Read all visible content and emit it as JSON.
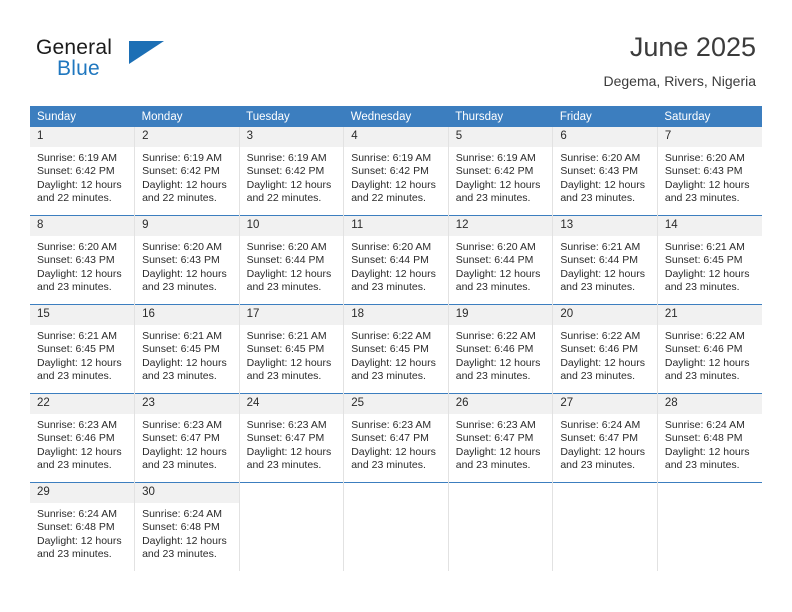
{
  "brand": {
    "word_one": "General",
    "word_two": "Blue",
    "flag_icon": "triangle-flag-icon",
    "colors": {
      "blue": "#1c6fb5",
      "text": "#1b1b1b"
    }
  },
  "header": {
    "title": "June 2025",
    "subtitle": "Degema, Rivers, Nigeria"
  },
  "theme": {
    "header_row_bg": "#3c7ebf",
    "daynum_bg": "#f1f1f1",
    "grid_line": "#e2e2e2",
    "week_divider": "#3c7ebf"
  },
  "calendar": {
    "weekday_headers": [
      "Sunday",
      "Monday",
      "Tuesday",
      "Wednesday",
      "Thursday",
      "Friday",
      "Saturday"
    ],
    "weeks": [
      [
        {
          "day": "1",
          "sunrise": "Sunrise: 6:19 AM",
          "sunset": "Sunset: 6:42 PM",
          "daylight_line1": "Daylight: 12 hours",
          "daylight_line2": "and 22 minutes."
        },
        {
          "day": "2",
          "sunrise": "Sunrise: 6:19 AM",
          "sunset": "Sunset: 6:42 PM",
          "daylight_line1": "Daylight: 12 hours",
          "daylight_line2": "and 22 minutes."
        },
        {
          "day": "3",
          "sunrise": "Sunrise: 6:19 AM",
          "sunset": "Sunset: 6:42 PM",
          "daylight_line1": "Daylight: 12 hours",
          "daylight_line2": "and 22 minutes."
        },
        {
          "day": "4",
          "sunrise": "Sunrise: 6:19 AM",
          "sunset": "Sunset: 6:42 PM",
          "daylight_line1": "Daylight: 12 hours",
          "daylight_line2": "and 22 minutes."
        },
        {
          "day": "5",
          "sunrise": "Sunrise: 6:19 AM",
          "sunset": "Sunset: 6:42 PM",
          "daylight_line1": "Daylight: 12 hours",
          "daylight_line2": "and 23 minutes."
        },
        {
          "day": "6",
          "sunrise": "Sunrise: 6:20 AM",
          "sunset": "Sunset: 6:43 PM",
          "daylight_line1": "Daylight: 12 hours",
          "daylight_line2": "and 23 minutes."
        },
        {
          "day": "7",
          "sunrise": "Sunrise: 6:20 AM",
          "sunset": "Sunset: 6:43 PM",
          "daylight_line1": "Daylight: 12 hours",
          "daylight_line2": "and 23 minutes."
        }
      ],
      [
        {
          "day": "8",
          "sunrise": "Sunrise: 6:20 AM",
          "sunset": "Sunset: 6:43 PM",
          "daylight_line1": "Daylight: 12 hours",
          "daylight_line2": "and 23 minutes."
        },
        {
          "day": "9",
          "sunrise": "Sunrise: 6:20 AM",
          "sunset": "Sunset: 6:43 PM",
          "daylight_line1": "Daylight: 12 hours",
          "daylight_line2": "and 23 minutes."
        },
        {
          "day": "10",
          "sunrise": "Sunrise: 6:20 AM",
          "sunset": "Sunset: 6:44 PM",
          "daylight_line1": "Daylight: 12 hours",
          "daylight_line2": "and 23 minutes."
        },
        {
          "day": "11",
          "sunrise": "Sunrise: 6:20 AM",
          "sunset": "Sunset: 6:44 PM",
          "daylight_line1": "Daylight: 12 hours",
          "daylight_line2": "and 23 minutes."
        },
        {
          "day": "12",
          "sunrise": "Sunrise: 6:20 AM",
          "sunset": "Sunset: 6:44 PM",
          "daylight_line1": "Daylight: 12 hours",
          "daylight_line2": "and 23 minutes."
        },
        {
          "day": "13",
          "sunrise": "Sunrise: 6:21 AM",
          "sunset": "Sunset: 6:44 PM",
          "daylight_line1": "Daylight: 12 hours",
          "daylight_line2": "and 23 minutes."
        },
        {
          "day": "14",
          "sunrise": "Sunrise: 6:21 AM",
          "sunset": "Sunset: 6:45 PM",
          "daylight_line1": "Daylight: 12 hours",
          "daylight_line2": "and 23 minutes."
        }
      ],
      [
        {
          "day": "15",
          "sunrise": "Sunrise: 6:21 AM",
          "sunset": "Sunset: 6:45 PM",
          "daylight_line1": "Daylight: 12 hours",
          "daylight_line2": "and 23 minutes."
        },
        {
          "day": "16",
          "sunrise": "Sunrise: 6:21 AM",
          "sunset": "Sunset: 6:45 PM",
          "daylight_line1": "Daylight: 12 hours",
          "daylight_line2": "and 23 minutes."
        },
        {
          "day": "17",
          "sunrise": "Sunrise: 6:21 AM",
          "sunset": "Sunset: 6:45 PM",
          "daylight_line1": "Daylight: 12 hours",
          "daylight_line2": "and 23 minutes."
        },
        {
          "day": "18",
          "sunrise": "Sunrise: 6:22 AM",
          "sunset": "Sunset: 6:45 PM",
          "daylight_line1": "Daylight: 12 hours",
          "daylight_line2": "and 23 minutes."
        },
        {
          "day": "19",
          "sunrise": "Sunrise: 6:22 AM",
          "sunset": "Sunset: 6:46 PM",
          "daylight_line1": "Daylight: 12 hours",
          "daylight_line2": "and 23 minutes."
        },
        {
          "day": "20",
          "sunrise": "Sunrise: 6:22 AM",
          "sunset": "Sunset: 6:46 PM",
          "daylight_line1": "Daylight: 12 hours",
          "daylight_line2": "and 23 minutes."
        },
        {
          "day": "21",
          "sunrise": "Sunrise: 6:22 AM",
          "sunset": "Sunset: 6:46 PM",
          "daylight_line1": "Daylight: 12 hours",
          "daylight_line2": "and 23 minutes."
        }
      ],
      [
        {
          "day": "22",
          "sunrise": "Sunrise: 6:23 AM",
          "sunset": "Sunset: 6:46 PM",
          "daylight_line1": "Daylight: 12 hours",
          "daylight_line2": "and 23 minutes."
        },
        {
          "day": "23",
          "sunrise": "Sunrise: 6:23 AM",
          "sunset": "Sunset: 6:47 PM",
          "daylight_line1": "Daylight: 12 hours",
          "daylight_line2": "and 23 minutes."
        },
        {
          "day": "24",
          "sunrise": "Sunrise: 6:23 AM",
          "sunset": "Sunset: 6:47 PM",
          "daylight_line1": "Daylight: 12 hours",
          "daylight_line2": "and 23 minutes."
        },
        {
          "day": "25",
          "sunrise": "Sunrise: 6:23 AM",
          "sunset": "Sunset: 6:47 PM",
          "daylight_line1": "Daylight: 12 hours",
          "daylight_line2": "and 23 minutes."
        },
        {
          "day": "26",
          "sunrise": "Sunrise: 6:23 AM",
          "sunset": "Sunset: 6:47 PM",
          "daylight_line1": "Daylight: 12 hours",
          "daylight_line2": "and 23 minutes."
        },
        {
          "day": "27",
          "sunrise": "Sunrise: 6:24 AM",
          "sunset": "Sunset: 6:47 PM",
          "daylight_line1": "Daylight: 12 hours",
          "daylight_line2": "and 23 minutes."
        },
        {
          "day": "28",
          "sunrise": "Sunrise: 6:24 AM",
          "sunset": "Sunset: 6:48 PM",
          "daylight_line1": "Daylight: 12 hours",
          "daylight_line2": "and 23 minutes."
        }
      ],
      [
        {
          "day": "29",
          "sunrise": "Sunrise: 6:24 AM",
          "sunset": "Sunset: 6:48 PM",
          "daylight_line1": "Daylight: 12 hours",
          "daylight_line2": "and 23 minutes."
        },
        {
          "day": "30",
          "sunrise": "Sunrise: 6:24 AM",
          "sunset": "Sunset: 6:48 PM",
          "daylight_line1": "Daylight: 12 hours",
          "daylight_line2": "and 23 minutes."
        },
        null,
        null,
        null,
        null,
        null
      ]
    ]
  }
}
